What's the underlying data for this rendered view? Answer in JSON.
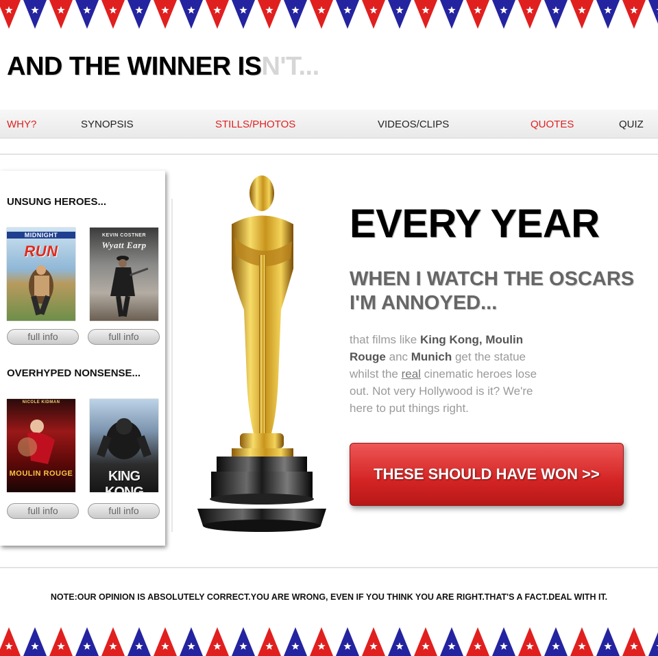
{
  "site": {
    "title_main": "AND THE WINNER IS",
    "title_fade": "N'T..."
  },
  "nav": [
    {
      "label": "WHY?",
      "active": true
    },
    {
      "label": "SYNOPSIS",
      "active": false
    },
    {
      "label": "STILLS/PHOTOS",
      "active": true
    },
    {
      "label": "VIDEOS/CLIPS",
      "active": false
    },
    {
      "label": "QUOTES",
      "active": true
    },
    {
      "label": "QUIZ",
      "active": false
    }
  ],
  "sidebar": {
    "unsung_heading": "UNSUNG HEROES...",
    "overhyped_heading": "OVERHYPED NONSENSE...",
    "posters": [
      {
        "caption": "RUN",
        "top_text": "MIDNIGHT"
      },
      {
        "caption": "Wyatt Earp",
        "top_text": "KEVIN COSTNER"
      },
      {
        "caption": "MOULIN ROUGE",
        "top_text": "NICOLE KIDMAN"
      },
      {
        "caption": "KING KONG",
        "top_text": ""
      }
    ],
    "info_label": "full info"
  },
  "hero": {
    "title": "EVERY YEAR",
    "subtitle": "WHEN I WATCH THE OSCARS I'M ANNOYED...",
    "text": {
      "p1": "that films like ",
      "b1": "King Kong, Moulin Rouge",
      "p2": " anc ",
      "b2": "Munich",
      "p3": " get the statue whilst the ",
      "u": "real",
      "p4": " cinematic heroes lose out. Not very Hollywood is it? We're here to put things right."
    },
    "cta_label": "THESE SHOULD HAVE WON >>"
  },
  "footer": {
    "note": "NOTE:OUR OPINION IS ABSOLUTELY CORRECT.YOU ARE WRONG, EVEN IF YOU THINK YOU ARE RIGHT.THAT'S A FACT.DEAL WITH IT."
  },
  "colors": {
    "red": "#e0201f",
    "blue": "#2424a0",
    "cta": "#d42424"
  }
}
